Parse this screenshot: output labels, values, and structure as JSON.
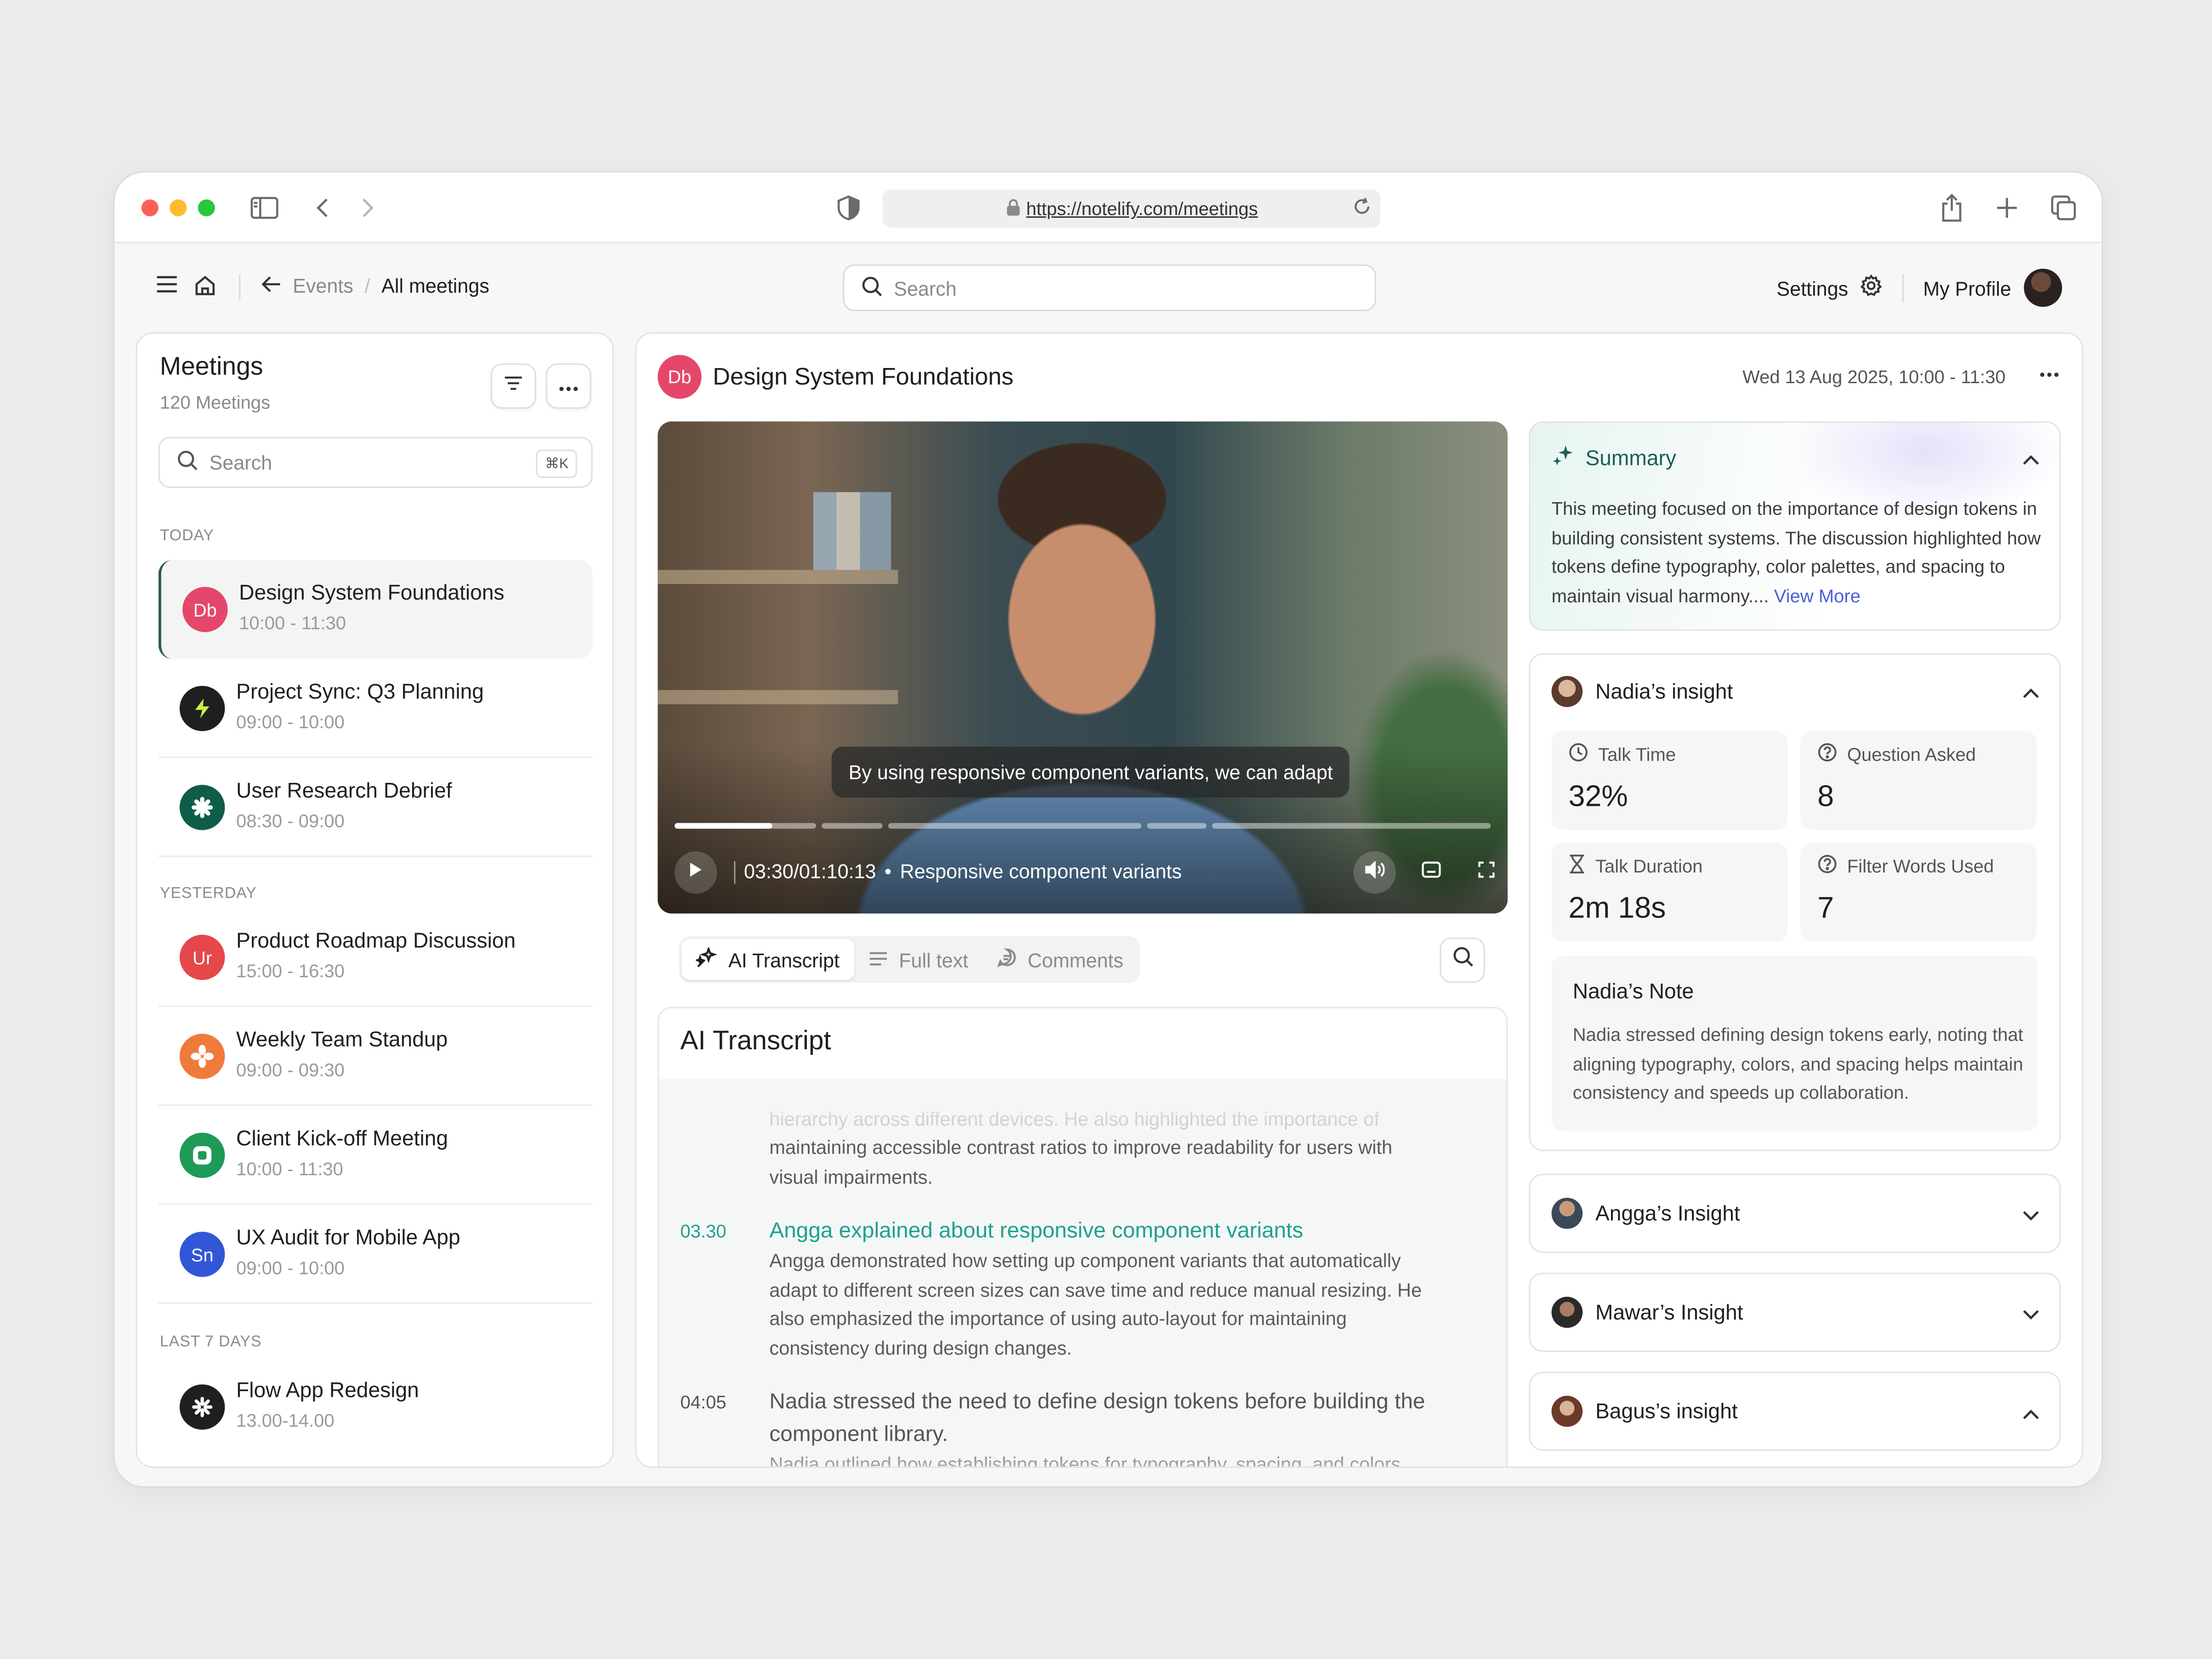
{
  "browser": {
    "url": "https://notelify.com/meetings"
  },
  "header": {
    "breadcrumb_parent": "Events",
    "breadcrumb_separator": "/",
    "breadcrumb_current": "All meetings",
    "search_placeholder": "Search",
    "settings_label": "Settings",
    "profile_label": "My Profile"
  },
  "sidebar": {
    "title": "Meetings",
    "count": "120 Meetings",
    "search_placeholder": "Search",
    "search_shortcut": "⌘K",
    "groups": {
      "today": "TODAY",
      "yesterday": "YESTERDAY",
      "last7": "LAST 7 DAYS"
    },
    "meetings": [
      {
        "title": "Design System Foundations",
        "time": "10:00 - 11:30",
        "initials": "Db",
        "color": "#e5476b",
        "active": true
      },
      {
        "title": "Project Sync: Q3 Planning",
        "time": "09:00 - 10:00",
        "icon": "bolt-icon",
        "color": "#1f1f1f"
      },
      {
        "title": "User Research Debrief",
        "time": "08:30 - 09:00",
        "icon": "asterisk-icon",
        "color": "#0f5c4a"
      },
      {
        "title": "Product Roadmap Discussion",
        "time": "15:00 - 16:30",
        "initials": "Ur",
        "color": "#e5474b"
      },
      {
        "title": "Weekly Team Standup",
        "time": "09:00 - 09:30",
        "icon": "flower-icon",
        "color": "#f07a3c"
      },
      {
        "title": "Client Kick-off Meeting",
        "time": "10:00 - 11:30",
        "icon": "square-ring-icon",
        "color": "#1e9a58"
      },
      {
        "title": "UX Audit for Mobile App",
        "time": "09:00 - 10:00",
        "initials": "Sn",
        "color": "#3157d6"
      },
      {
        "title": "Flow App Redesign",
        "time": "13.00-14.00",
        "icon": "spark-icon",
        "color": "#1f1f1f"
      }
    ]
  },
  "meeting": {
    "initials": "Db",
    "title": "Design System Foundations",
    "date": "Wed 13 Aug 2025, 10:00 - 11:30"
  },
  "video": {
    "caption": "By using responsive component variants, we can adapt",
    "time": "03:30/01:10:13",
    "separator": "•",
    "chapter": "Responsive component variants",
    "progress": 0.12
  },
  "tabs": [
    {
      "label": "AI Transcript",
      "active": true
    },
    {
      "label": "Full text",
      "active": false
    },
    {
      "label": "Comments",
      "active": false
    }
  ],
  "transcript": {
    "title": "AI Transcript",
    "intro_faded": "hierarchy across different devices. He also highlighted the importance of",
    "intro": "maintaining accessible contrast ratios to improve readability for users with visual impairments.",
    "entries": [
      {
        "time": "03.30",
        "title": "Angga explained about responsive component variants",
        "text": "Angga demonstrated how setting up component variants that automatically adapt to different screen sizes can save time and reduce manual resizing. He also emphasized the importance of using auto-layout for maintaining consistency during design changes."
      },
      {
        "time": "04:05",
        "title": "Nadia stressed the need to define design tokens before building the component library.",
        "text": "Nadia outlined how establishing tokens for typography, spacing, and colors"
      }
    ]
  },
  "summary": {
    "title": "Summary",
    "text": "This meeting focused on the importance of design tokens in building consistent systems. The discussion highlighted how tokens define typography, color palettes, and spacing to maintain visual harmony....",
    "more": "View More"
  },
  "insight": {
    "title": "Nadia’s insight",
    "stats": [
      {
        "label": "Talk Time",
        "value": "32%",
        "icon": "clock-icon"
      },
      {
        "label": "Question Asked",
        "value": "8",
        "icon": "question-icon"
      },
      {
        "label": "Talk Duration",
        "value": "2m 18s",
        "icon": "hourglass-icon"
      },
      {
        "label": "Filter Words Used",
        "value": "7",
        "icon": "question-icon"
      }
    ],
    "note_title": "Nadia’s Note",
    "note_text": "Nadia stressed defining design tokens early, noting that aligning typography, colors, and spacing helps maintain consistency and speeds up collaboration."
  },
  "other_insights": [
    {
      "label": "Angga’s Insight",
      "expanded": false
    },
    {
      "label": "Mawar’s Insight",
      "expanded": false
    },
    {
      "label": "Bagus’s insight",
      "expanded": true
    }
  ],
  "colors": {
    "accent": "#1d5f55",
    "transcript_highlight": "#1fa08f",
    "link": "#4760d6"
  }
}
